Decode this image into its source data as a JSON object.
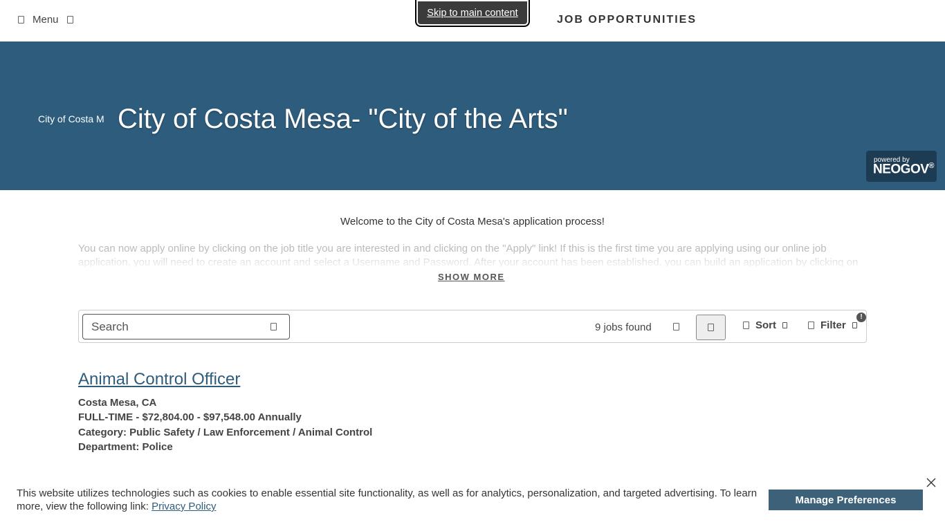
{
  "header": {
    "menu_label": "Menu",
    "skip_link": "Skip to main content",
    "nav_title": "JOB OPPORTUNITIES"
  },
  "hero": {
    "logo_alt": "City of Costa Mesa",
    "title": "City of Costa Mesa- \"City of the Arts\"",
    "powered_by": "powered by",
    "brand": "NEOGOV"
  },
  "intro": {
    "welcome": "Welcome to the City of Costa Mesa's application process!",
    "body": "You can now apply online by clicking on the job title you are interested in and clicking on the \"Apply\" link! If this is the first time you are applying using our online job application, you will need to create an account and select a Username and Password. After your account has been established, you can build an application by clicking on",
    "show_more": "SHOW MORE"
  },
  "toolbar": {
    "search_placeholder": "Search",
    "jobs_found": "9 jobs found",
    "sort_label": "Sort",
    "filter_label": "Filter",
    "info_badge": "!"
  },
  "jobs": [
    {
      "title": "Animal Control Officer",
      "location": "Costa Mesa, CA",
      "salary": "FULL-TIME - $72,804.00 - $97,548.00 Annually",
      "category": "Category: Public Safety / Law Enforcement / Animal Control",
      "department": "Department: Police"
    }
  ],
  "cookie": {
    "text": "This website utilizes technologies such as cookies to enable essential site functionality, as well as for analytics, personalization, and targeted advertising. To learn more, view the following link:",
    "link_label": "Privacy Policy",
    "button_label": "Manage Preferences"
  },
  "colors": {
    "hero_bg": "#2e5c7c",
    "link": "#2e5c7c",
    "button_bg": "#3c6178"
  }
}
